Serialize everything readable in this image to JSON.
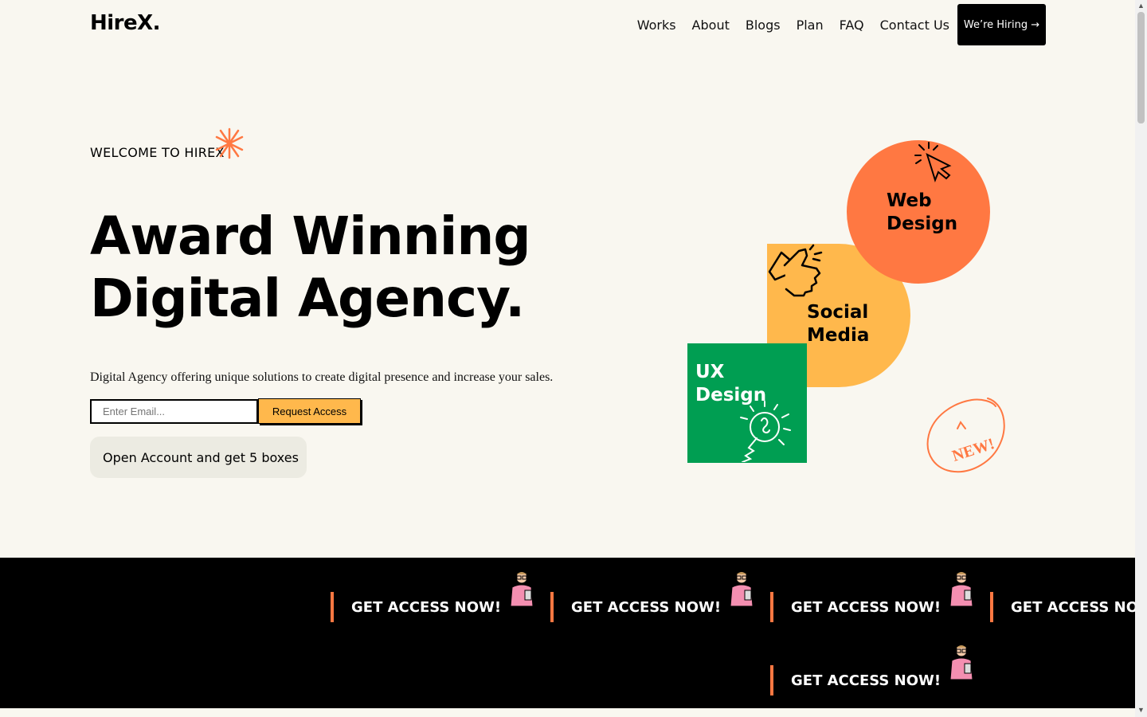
{
  "header": {
    "logo": "HireX.",
    "nav": [
      "Works",
      "About",
      "Blogs",
      "Plan",
      "FAQ",
      "Contact Us"
    ],
    "cta": "We’re Hiring →"
  },
  "hero": {
    "eyebrow": "WELCOME TO HIREX",
    "headline_line1": "Award Winning",
    "headline_line2": "Digital Agency.",
    "subtitle": "Digital Agency offering unique solutions to create digital presence and increase your sales.",
    "email_placeholder": "Enter Email...",
    "request_label": "Request Access",
    "open_account": "Open Account and get 5 boxes"
  },
  "services": {
    "web_line1": "Web",
    "web_line2": "Design",
    "social_line1": "Social",
    "social_line2": "Media",
    "ux_line1": "UX",
    "ux_line2": "Design",
    "badge": "NEW!"
  },
  "marquee": {
    "label": "GET ACCESS NOW!"
  },
  "colors": {
    "orange": "#ff7842",
    "yellow": "#ffb84c",
    "green": "#009e52",
    "background": "#f9f7f0"
  }
}
